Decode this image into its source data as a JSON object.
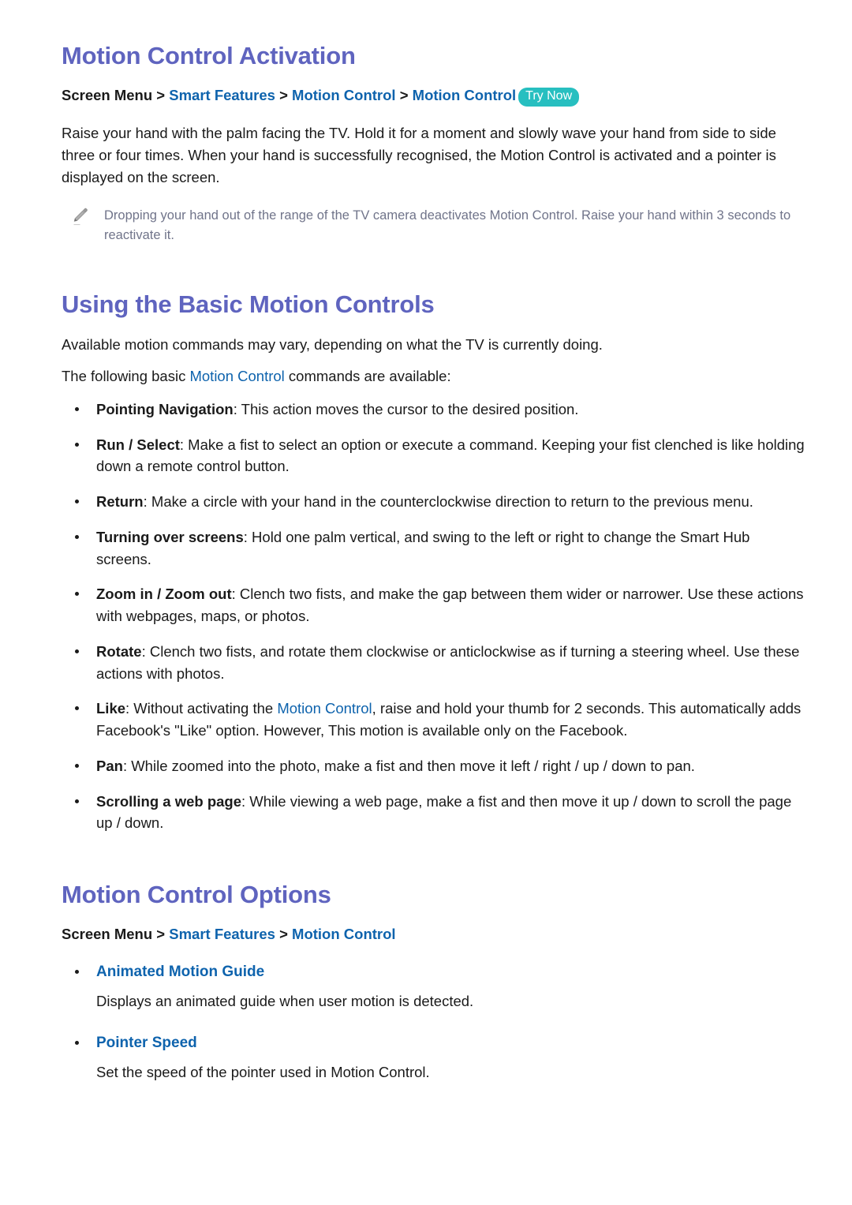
{
  "colors": {
    "heading": "#5f64bf",
    "link": "#0e63ad",
    "badge_bg": "#27bfc0",
    "note_text": "#70748a",
    "body_text": "#1a1a1a"
  },
  "section1": {
    "title": "Motion Control Activation",
    "breadcrumb": {
      "root": "Screen Menu",
      "sep": ">",
      "items": [
        {
          "label": "Smart Features"
        },
        {
          "label": "Motion Control"
        },
        {
          "label": "Motion Control"
        }
      ],
      "badge": "Try Now"
    },
    "paragraph": "Raise your hand with the palm facing the TV. Hold it for a moment and slowly wave your hand from side to side three or four times. When your hand is successfully recognised, the Motion Control is activated and a pointer is displayed on the screen.",
    "note": {
      "icon": "pencil-icon",
      "text": "Dropping your hand out of the range of the TV camera deactivates Motion Control. Raise your hand within 3 seconds to reactivate it."
    }
  },
  "section2": {
    "title": "Using the Basic Motion Controls",
    "intro1": "Available motion commands may vary, depending on what the TV is currently doing.",
    "intro2_before": "The following basic ",
    "intro2_link": "Motion Control",
    "intro2_after": " commands are available:",
    "items": [
      {
        "term": "Pointing Navigation",
        "text": ": This action moves the cursor to the desired position."
      },
      {
        "term": "Run / Select",
        "text": ": Make a fist to select an option or execute a command. Keeping your fist clenched is like holding down a remote control button."
      },
      {
        "term": "Return",
        "text": ": Make a circle with your hand in the counterclockwise direction to return to the previous menu."
      },
      {
        "term": "Turning over screens",
        "text": ": Hold one palm vertical, and swing to the left or right to change the Smart Hub screens."
      },
      {
        "term": "Zoom in / Zoom out",
        "text": ": Clench two fists, and make the gap between them wider or narrower. Use these actions with webpages, maps, or photos."
      },
      {
        "term": "Rotate",
        "text": ": Clench two fists, and rotate them clockwise or anticlockwise as if turning a steering wheel. Use these actions with photos."
      },
      {
        "term": "Like",
        "text_before": ": Without activating the ",
        "link": "Motion Control",
        "text_after": ", raise and hold your thumb for 2 seconds. This automatically adds Facebook's \"Like\" option. However, This motion is available only on the Facebook."
      },
      {
        "term": "Pan",
        "text": ": While zoomed into the photo, make a fist and then move it left / right / up / down to pan."
      },
      {
        "term": "Scrolling a web page",
        "text": ": While viewing a web page, make a fist and then move it up / down to scroll the page up / down."
      }
    ]
  },
  "section3": {
    "title": "Motion Control Options",
    "breadcrumb": {
      "root": "Screen Menu",
      "sep": ">",
      "items": [
        {
          "label": "Smart Features"
        },
        {
          "label": "Motion Control"
        }
      ]
    },
    "options": [
      {
        "name": "Animated Motion Guide",
        "desc": "Displays an animated guide when user motion is detected."
      },
      {
        "name": "Pointer Speed",
        "desc": "Set the speed of the pointer used in Motion Control."
      }
    ]
  }
}
